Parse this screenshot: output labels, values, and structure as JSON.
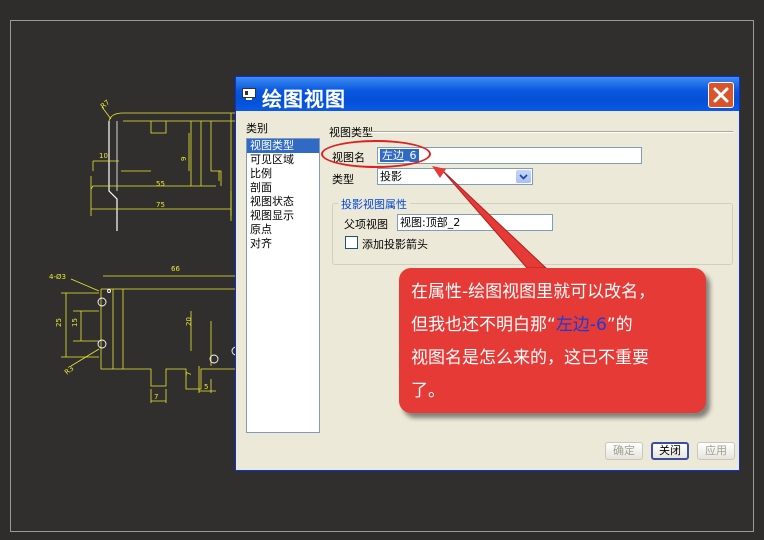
{
  "dialog": {
    "title": "绘图视图",
    "categories_label": "类别",
    "categories": [
      {
        "label": "视图类型",
        "selected": true
      },
      {
        "label": "可见区域",
        "selected": false
      },
      {
        "label": "比例",
        "selected": false
      },
      {
        "label": "剖面",
        "selected": false
      },
      {
        "label": "视图状态",
        "selected": false
      },
      {
        "label": "视图显示",
        "selected": false
      },
      {
        "label": "原点",
        "selected": false
      },
      {
        "label": "对齐",
        "selected": false
      }
    ],
    "section_title": "视图类型",
    "view_name_label": "视图名",
    "view_name_value": "左边_6",
    "type_label": "类型",
    "type_value": "投影",
    "projection_group_title": "投影视图属性",
    "parent_view_label": "父项视图",
    "parent_view_value": "视图:顶部_2",
    "add_arrow_label": "添加投影箭头",
    "add_arrow_checked": false,
    "buttons": {
      "ok": "确定",
      "close": "关闭",
      "apply": "应用"
    }
  },
  "callout": {
    "line1": "在属性-绘图视图里就可以改名，",
    "line2_before": "但我也还不明白那“",
    "line2_highlight": "左边-6",
    "line2_after": "”的",
    "line3": "视图名是怎么来的，这已不重要",
    "line4": "了。"
  },
  "drawing": {
    "dims_top": {
      "r_label": "R7",
      "d10": "10",
      "d9": "9",
      "d55": "55",
      "d75": "75"
    },
    "dims_bottom": {
      "hole": "4-Ø3",
      "d66": "66",
      "d25": "25",
      "d15": "15",
      "d20": "20",
      "r3": "R3",
      "d7a": "7",
      "d7b": "7",
      "d5": "5"
    }
  },
  "colors": {
    "accent_title": "#0450d6",
    "callout_bg": "#e63a37",
    "highlight_text": "#1a3cd8",
    "cad_line": "#e8e830"
  }
}
